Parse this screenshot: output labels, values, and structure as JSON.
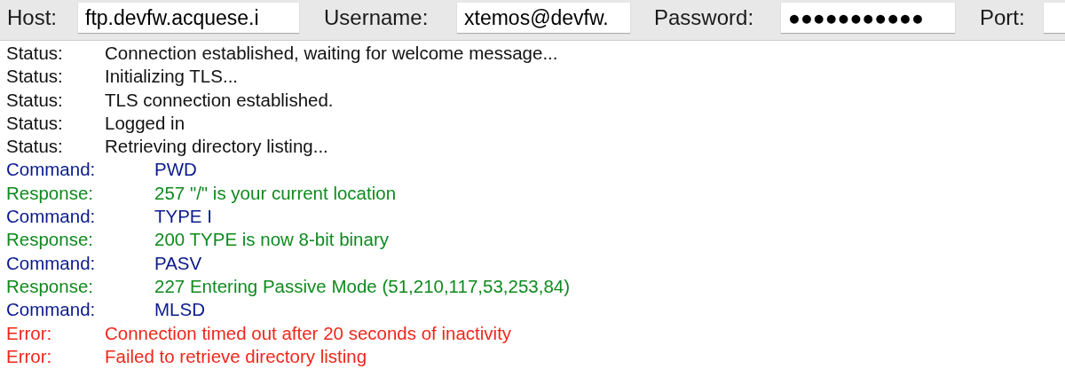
{
  "quickconnect": {
    "fields": [
      {
        "label": "Host:",
        "value": "ftp.devfw.acquese.i"
      },
      {
        "label": "Username:",
        "value": "xtemos@devfw."
      },
      {
        "label": "Password:",
        "value": "●●●●●●●●●●●"
      },
      {
        "label": "Port:"
      }
    ]
  },
  "log": [
    {
      "kind": "status",
      "label": "Status:",
      "message": "Connection established, waiting for welcome message..."
    },
    {
      "kind": "status",
      "label": "Status:",
      "message": "Initializing TLS..."
    },
    {
      "kind": "status",
      "label": "Status:",
      "message": "TLS connection established."
    },
    {
      "kind": "status",
      "label": "Status:",
      "message": "Logged in"
    },
    {
      "kind": "status",
      "label": "Status:",
      "message": "Retrieving directory listing..."
    },
    {
      "kind": "command",
      "label": "Command:",
      "message": "PWD"
    },
    {
      "kind": "response",
      "label": "Response:",
      "message": "257 \"/\" is your current location"
    },
    {
      "kind": "command",
      "label": "Command:",
      "message": "TYPE I"
    },
    {
      "kind": "response",
      "label": "Response:",
      "message": "200 TYPE is now 8-bit binary"
    },
    {
      "kind": "command",
      "label": "Command:",
      "message": "PASV"
    },
    {
      "kind": "response",
      "label": "Response:",
      "message": "227 Entering Passive Mode (51,210,117,53,253,84)"
    },
    {
      "kind": "command",
      "label": "Command:",
      "message": "MLSD"
    },
    {
      "kind": "error",
      "label": "Error:",
      "message": "Connection timed out after 20 seconds of inactivity"
    },
    {
      "kind": "error",
      "label": "Error:",
      "message": "Failed to retrieve directory listing"
    }
  ]
}
